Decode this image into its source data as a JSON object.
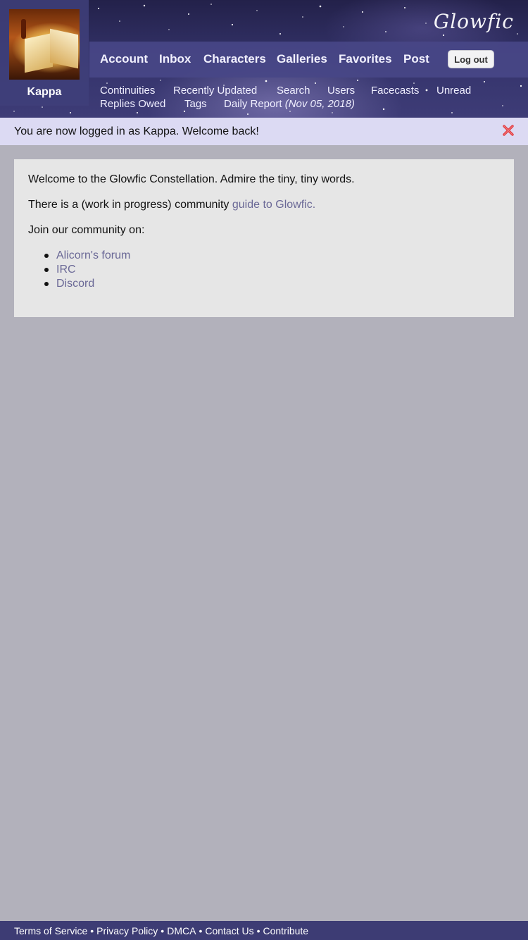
{
  "site": {
    "logo": "Glowfic"
  },
  "user": {
    "name": "Kappa"
  },
  "nav": {
    "main": [
      "Account",
      "Inbox",
      "Characters",
      "Galleries",
      "Favorites",
      "Post"
    ],
    "logout_label": "Log out",
    "secondary": [
      "Continuities",
      "Recently Updated",
      "Search",
      "Users",
      "Facecasts",
      "Unread",
      "Replies Owed",
      "Tags"
    ],
    "daily_report": {
      "label": "Daily Report",
      "date": "(Nov 05, 2018)"
    }
  },
  "flash": {
    "message": "You are now logged in as Kappa. Welcome back!"
  },
  "content": {
    "welcome": "Welcome to the Glowfic Constellation. Admire the tiny, tiny words.",
    "guide_prefix": "There is a (work in progress) community",
    "guide_link": "guide to Glowfic.",
    "join_text": "Join our community on:",
    "community_links": [
      "Alicorn's forum",
      "IRC",
      "Discord"
    ]
  },
  "footer": {
    "links": [
      "Terms of Service",
      "Privacy Policy",
      "DMCA",
      "Contact Us",
      "Contribute"
    ],
    "separator": "•"
  },
  "colors": {
    "header_bg": "#35346c",
    "nav_bg": "#484687",
    "flash_bg": "#dcdaf3",
    "page_bg": "#b2b1bb",
    "content_bg": "#e6e6e6",
    "link": "#6a6896",
    "close_icon": "#e0393e"
  },
  "icons": {
    "close": "close-icon"
  }
}
